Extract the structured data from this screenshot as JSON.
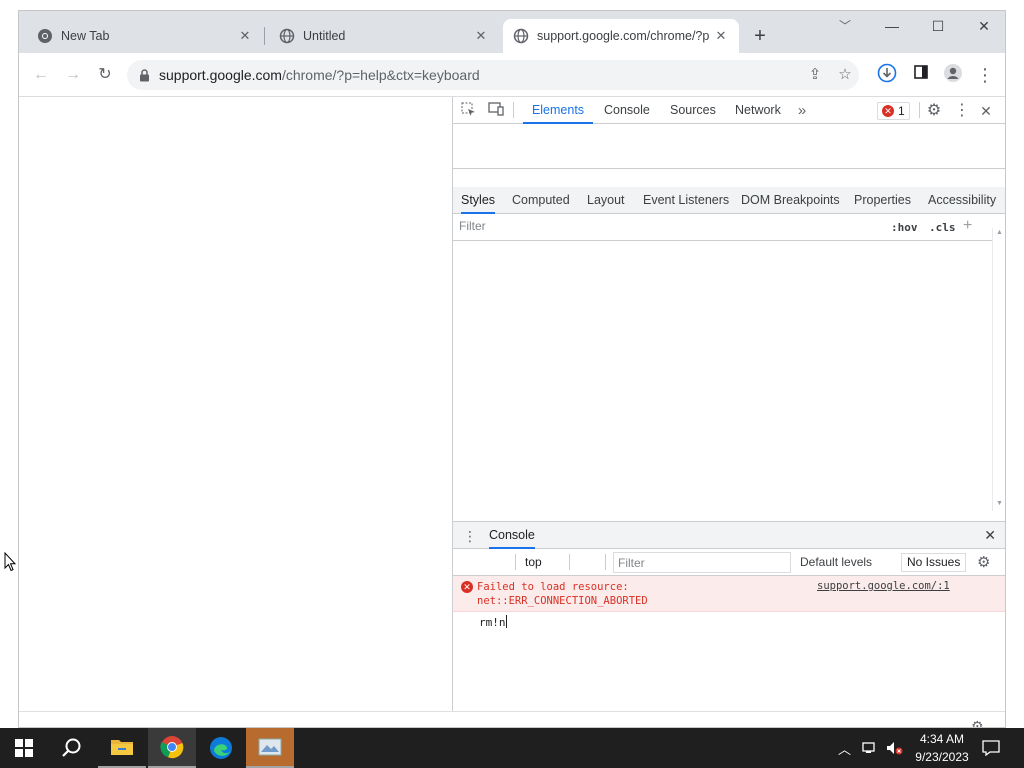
{
  "tabs": [
    {
      "title": "New Tab"
    },
    {
      "title": "Untitled"
    },
    {
      "title": "support.google.com/chrome/?p"
    }
  ],
  "address": {
    "host": "support.google.com",
    "path": "/chrome/?p=help&ctx=keyboard"
  },
  "devtools": {
    "tabs": [
      "Elements",
      "Console",
      "Sources",
      "Network"
    ],
    "error_count": "1",
    "sub_tabs": [
      "Styles",
      "Computed",
      "Layout",
      "Event Listeners",
      "DOM Breakpoints",
      "Properties",
      "Accessibility"
    ],
    "styles_filter_placeholder": "Filter",
    "hov": ":hov",
    "cls": ".cls"
  },
  "drawer": {
    "tab": "Console",
    "context": "top",
    "filter_placeholder": "Filter",
    "levels": "Default levels",
    "issues": "No Issues",
    "error_line1": "Failed to load resource:",
    "error_line2": "net::ERR_CONNECTION_ABORTED",
    "error_source": "support.google.com/:1",
    "prompt_text": "rm!n"
  },
  "taskbar": {
    "time": "4:34 AM",
    "date": "9/23/2023"
  },
  "colors": {
    "accent": "#1a73e8",
    "error": "#d93025",
    "error_bg": "#fcebeb"
  }
}
